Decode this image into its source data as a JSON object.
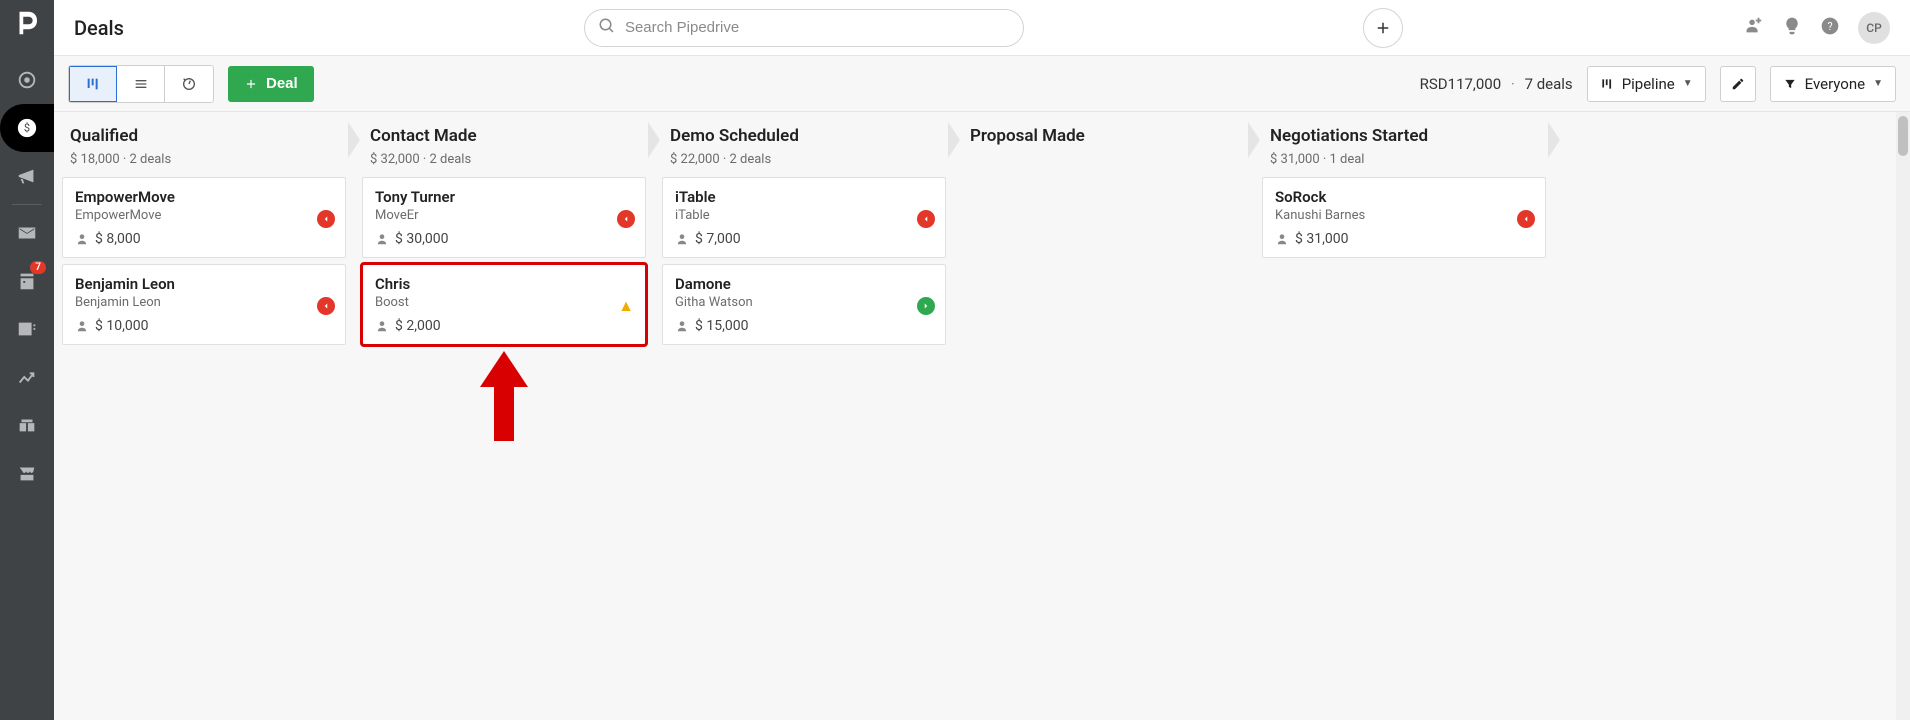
{
  "header": {
    "title": "Deals",
    "search_placeholder": "Search Pipedrive",
    "avatar_initials": "CP"
  },
  "leftnav": {
    "badge_activities": "7"
  },
  "toolbar": {
    "deal_button_label": "Deal",
    "summary_value": "RSD117,000",
    "summary_deals": "7 deals",
    "pipeline_label": "Pipeline",
    "filter_label": "Everyone"
  },
  "stages": [
    {
      "name": "Qualified",
      "meta": "$ 18,000 · 2 deals",
      "cards": [
        {
          "title": "EmpowerMove",
          "sub": "EmpowerMove",
          "amount": "$ 8,000",
          "status": "red"
        },
        {
          "title": "Benjamin Leon",
          "sub": "Benjamin Leon",
          "amount": "$ 10,000",
          "status": "red"
        }
      ]
    },
    {
      "name": "Contact Made",
      "meta": "$ 32,000 · 2 deals",
      "cards": [
        {
          "title": "Tony Turner",
          "sub": "MoveEr",
          "amount": "$ 30,000",
          "status": "red"
        },
        {
          "title": "Chris",
          "sub": "Boost",
          "amount": "$ 2,000",
          "status": "yellow",
          "highlight": true
        }
      ]
    },
    {
      "name": "Demo Scheduled",
      "meta": "$ 22,000 · 2 deals",
      "cards": [
        {
          "title": "iTable",
          "sub": "iTable",
          "amount": "$ 7,000",
          "status": "red"
        },
        {
          "title": "Damone",
          "sub": "Githa Watson",
          "amount": "$ 15,000",
          "status": "green"
        }
      ]
    },
    {
      "name": "Proposal Made",
      "meta": "",
      "cards": []
    },
    {
      "name": "Negotiations Started",
      "meta": "$ 31,000 · 1 deal",
      "cards": [
        {
          "title": "SoRock",
          "sub": "Kanushi Barnes",
          "amount": "$ 31,000",
          "status": "red"
        }
      ]
    }
  ]
}
